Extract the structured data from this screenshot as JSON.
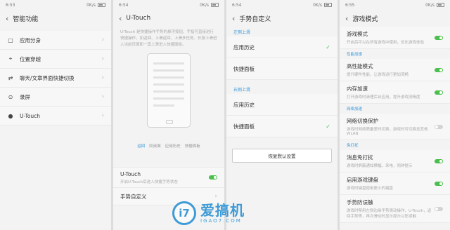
{
  "panels": [
    {
      "time": "6:53",
      "net": "0K/s",
      "title": "",
      "items": []
    }
  ],
  "p1": {
    "time": "6:53",
    "net": "0K/s",
    "title": "智能功能",
    "items": [
      {
        "label": "应用分身",
        "icon": "▢"
      },
      {
        "label": "位置穿越",
        "icon": "⌖"
      },
      {
        "label": "聊天/文章界面快捷切换",
        "icon": "⇄"
      },
      {
        "label": "录屏",
        "icon": "⊙"
      },
      {
        "label": "U-Touch",
        "icon": "●"
      }
    ]
  },
  "p2": {
    "time": "6:54",
    "net": "0K/s",
    "title": "U-Touch",
    "desc": "U-Touch 是快捷操作手势的悬浮按钮，手指可直接进行快捷操作，如返回、上滑返回、上滑多任务、长按上滑进入当前页面和一直上滑进入快捷面板。",
    "tabs": [
      "返回",
      "回桌面",
      "应用历史",
      "快捷面板"
    ],
    "toggle_title": "U-Touch",
    "toggle_sub": "开启U-Touch后进入快捷手势状态",
    "gesture_label": "手势自定义"
  },
  "p3": {
    "time": "6:54",
    "net": "0K/s",
    "title": "手势自定义",
    "sec1": "左侧上滑",
    "sec1_items": [
      "应用历史",
      "快捷面板"
    ],
    "sec2": "右侧上滑",
    "sec2_items": [
      "应用历史",
      "快捷面板"
    ],
    "reset": "恢复默认设置"
  },
  "p4": {
    "time": "6:55",
    "net": "0K/s",
    "title": "游戏模式",
    "items": [
      {
        "title": "游戏模式",
        "sub": "开启后可以在所有游戏中使用，优化游戏体验",
        "toggle": "on"
      },
      {
        "section": "性能加速"
      },
      {
        "title": "高性能模式",
        "sub": "提升硬件性能，让游戏运行更加流畅",
        "toggle": "on"
      },
      {
        "title": "内存加速",
        "sub": "打开游戏时清理后台应用，提升游戏流畅度",
        "toggle": "on"
      },
      {
        "section": "网络加速"
      },
      {
        "title": "网络切换保护",
        "sub": "游戏时网络质量差时切换，游戏时可切换至其他WLAN",
        "toggle": "off"
      },
      {
        "section": "免打扰"
      },
      {
        "title": "消息免打扰",
        "sub": "游戏时屏蔽通知横幅，来电，闹钟提示",
        "toggle": "on"
      },
      {
        "title": "启用游戏键盘",
        "sub": "游戏时键盘使用更小的键盘",
        "toggle": "on"
      },
      {
        "title": "手势防误触",
        "sub": "游戏时禁用左侧边缘手势滑动操作，U-Touch，返回手势等，再次滑动时显示提示以防误触",
        "toggle": "off"
      }
    ]
  },
  "watermark": {
    "mark": "i7",
    "cn": "爱搞机",
    "url": "IGAO7.COM"
  },
  "colors": {
    "accent": "#3b98d8",
    "toggle_on": "#4bbf4b",
    "toggle_off": "#d4d4d4",
    "logo": "#3f9bd6"
  }
}
